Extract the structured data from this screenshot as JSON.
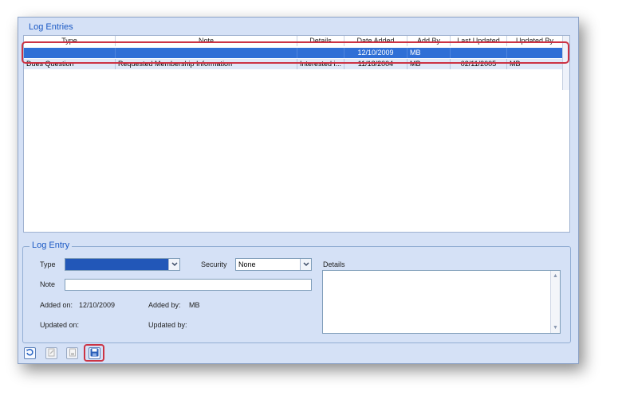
{
  "log_entries": {
    "title": "Log Entries",
    "columns": [
      "Type",
      "Note",
      "Details",
      "Date Added",
      "Add By",
      "Last Updated",
      "Updated By"
    ],
    "rows": [
      {
        "type": "",
        "note": "",
        "details": "",
        "date_added": "12/10/2009",
        "add_by": "MB",
        "last_updated": "",
        "updated_by": ""
      },
      {
        "type": "Dues Question",
        "note": "Requested Membership Information",
        "details": "Interested i...",
        "date_added": "11/18/2004",
        "add_by": "MB",
        "last_updated": "02/11/2005",
        "updated_by": "MB"
      }
    ]
  },
  "log_entry": {
    "title": "Log Entry",
    "type_label": "Type",
    "type_value": "",
    "security_label": "Security",
    "security_value": "None",
    "details_label": "Details",
    "details_value": "",
    "note_label": "Note",
    "note_value": "",
    "added_on_label": "Added on:",
    "added_on_value": "12/10/2009",
    "added_by_label": "Added by:",
    "added_by_value": "MB",
    "updated_on_label": "Updated on:",
    "updated_on_value": "",
    "updated_by_label": "Updated by:",
    "updated_by_value": ""
  },
  "toolbar": {
    "buttons": [
      {
        "name": "refresh-button",
        "icon": "refresh-icon",
        "enabled": true
      },
      {
        "name": "edit-button",
        "icon": "edit-icon",
        "enabled": false
      },
      {
        "name": "delete-button",
        "icon": "delete-icon",
        "enabled": false
      },
      {
        "name": "save-button",
        "icon": "save-icon",
        "enabled": true
      }
    ]
  },
  "colors": {
    "selection": "#2f6fd6",
    "highlight": "#cc3344",
    "panel": "#d5e1f6",
    "title": "#1b59c4"
  }
}
